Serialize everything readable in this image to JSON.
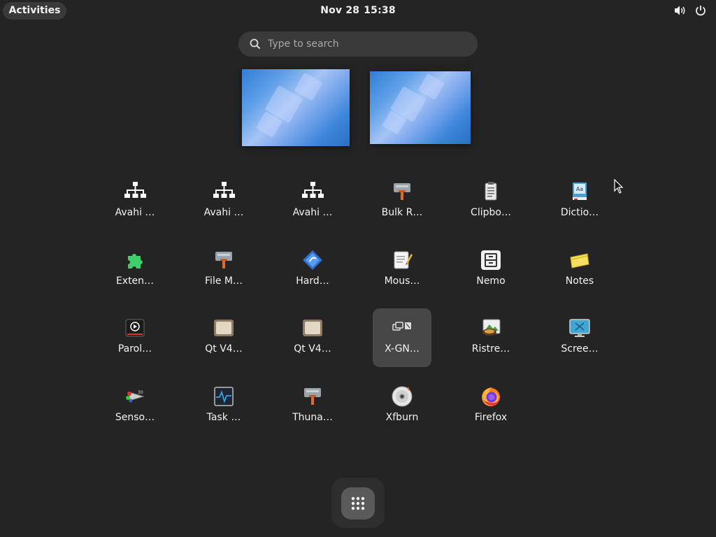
{
  "topbar": {
    "activities_label": "Activities",
    "date": "Nov 28",
    "time": "15:38",
    "icons": [
      "volume-icon",
      "power-icon"
    ]
  },
  "search": {
    "placeholder": "Type to search",
    "value": ""
  },
  "workspaces": [
    {
      "name": "workspace-1"
    },
    {
      "name": "workspace-2"
    }
  ],
  "apps": [
    {
      "label": "Avahi …",
      "icon": "network-icon"
    },
    {
      "label": "Avahi …",
      "icon": "network-icon"
    },
    {
      "label": "Avahi …",
      "icon": "network-icon"
    },
    {
      "label": "Bulk R…",
      "icon": "generic-app-icon"
    },
    {
      "label": "Clipbo…",
      "icon": "clipboard-icon"
    },
    {
      "label": "Dictio…",
      "icon": "dictionary-icon"
    },
    {
      "label": "Exten…",
      "icon": "puzzle-icon"
    },
    {
      "label": "File M…",
      "icon": "generic-app-icon"
    },
    {
      "label": "Hard…",
      "icon": "hardinfo-icon"
    },
    {
      "label": "Mous…",
      "icon": "notepad-icon"
    },
    {
      "label": "Nemo",
      "icon": "file-cabinet-icon"
    },
    {
      "label": "Notes",
      "icon": "notes-icon"
    },
    {
      "label": "Parol…",
      "icon": "media-player-icon"
    },
    {
      "label": "Qt V4…",
      "icon": "webcam-icon"
    },
    {
      "label": "Qt V4…",
      "icon": "webcam-icon"
    },
    {
      "label": "X-GN…",
      "icon": "xgnome-icon"
    },
    {
      "label": "Ristre…",
      "icon": "ristretto-icon"
    },
    {
      "label": "Scree…",
      "icon": "screensaver-icon"
    },
    {
      "label": "Senso…",
      "icon": "sensors-icon"
    },
    {
      "label": "Task …",
      "icon": "task-manager-icon"
    },
    {
      "label": "Thuna…",
      "icon": "generic-app-icon"
    },
    {
      "label": "Xfburn",
      "icon": "disc-icon"
    },
    {
      "label": "Firefox",
      "icon": "firefox-icon"
    }
  ],
  "highlighted_app": "X-GN…",
  "dock": {
    "show_apps_icon": "grid-icon"
  },
  "colors": {
    "background": "#242424",
    "panel": "#3a3a3a",
    "highlight": "#474747"
  }
}
